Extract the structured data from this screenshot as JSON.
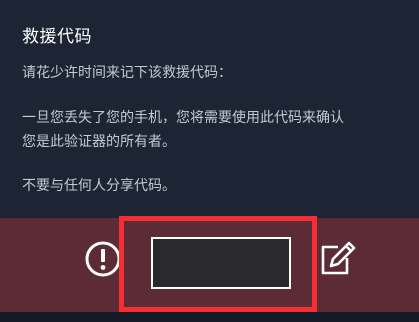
{
  "dialog": {
    "title": "救援代码",
    "paragraph1": "请花少许时间来记下该救援代码：",
    "paragraph2_line1": "一旦您丢失了您的手机，您将需要使用此代码来确认",
    "paragraph2_line2": "您是此验证器的所有者。",
    "paragraph3": "不要与任何人分享代码。"
  },
  "bottom_bar": {
    "left_icon": "alert-circle-icon",
    "right_icon": "edit-pencil-icon",
    "code_value": ""
  },
  "colors": {
    "dialog_bg": "#1d2535",
    "bar_bg": "#5c2b35",
    "highlight": "#f42f33"
  }
}
